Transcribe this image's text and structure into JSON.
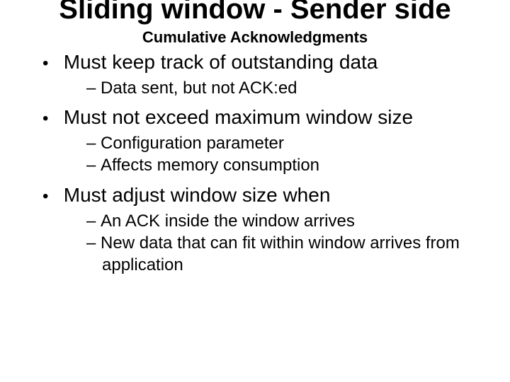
{
  "slide": {
    "title": "Sliding window - Sender side",
    "subtitle": "Cumulative Acknowledgments",
    "bullets": [
      {
        "text": "Must keep track of outstanding data",
        "sub": [
          "Data sent, but not ACK:ed"
        ]
      },
      {
        "text": "Must not exceed maximum window size",
        "sub": [
          "Configuration parameter",
          "Affects memory consumption"
        ]
      },
      {
        "text": "Must adjust window size when",
        "sub": [
          "An ACK inside the window arrives",
          "New data that can fit within window arrives from application"
        ]
      }
    ]
  }
}
